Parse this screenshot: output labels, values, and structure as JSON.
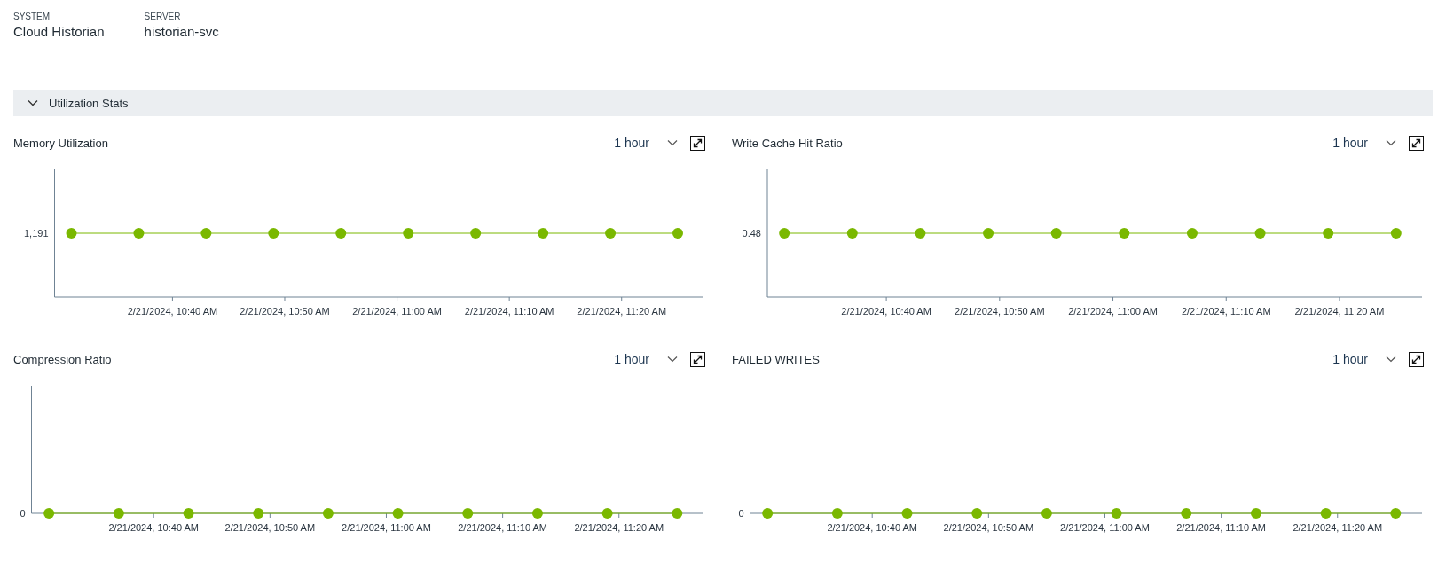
{
  "header": {
    "fields": [
      {
        "label": "SYSTEM",
        "value": "Cloud Historian"
      },
      {
        "label": "SERVER",
        "value": "historian-svc"
      }
    ]
  },
  "section": {
    "title": "Utilization Stats",
    "expanded": true
  },
  "panels": [
    {
      "title": "Memory Utilization",
      "range": "1 hour",
      "kind": "midline",
      "y_label": "1,191",
      "x_labels": [
        "2/21/2024, 10:40 AM",
        "2/21/2024, 10:50 AM",
        "2/21/2024, 11:00 AM",
        "2/21/2024, 11:10 AM",
        "2/21/2024, 11:20 AM"
      ]
    },
    {
      "title": "Write Cache Hit Ratio",
      "range": "1 hour",
      "kind": "midline",
      "y_label": "0.48",
      "x_labels": [
        "2/21/2024, 10:40 AM",
        "2/21/2024, 10:50 AM",
        "2/21/2024, 11:00 AM",
        "2/21/2024, 11:10 AM",
        "2/21/2024, 11:20 AM"
      ]
    },
    {
      "title": "Compression Ratio",
      "range": "1 hour",
      "kind": "baseline",
      "y_label": "0",
      "x_labels": [
        "2/21/2024, 10:40 AM",
        "2/21/2024, 10:50 AM",
        "2/21/2024, 11:00 AM",
        "2/21/2024, 11:10 AM",
        "2/21/2024, 11:20 AM"
      ]
    },
    {
      "title": "FAILED WRITES",
      "range": "1 hour",
      "kind": "baseline",
      "y_label": "0",
      "x_labels": [
        "2/21/2024, 10:40 AM",
        "2/21/2024, 10:50 AM",
        "2/21/2024, 11:00 AM",
        "2/21/2024, 11:10 AM",
        "2/21/2024, 11:20 AM"
      ]
    }
  ]
}
